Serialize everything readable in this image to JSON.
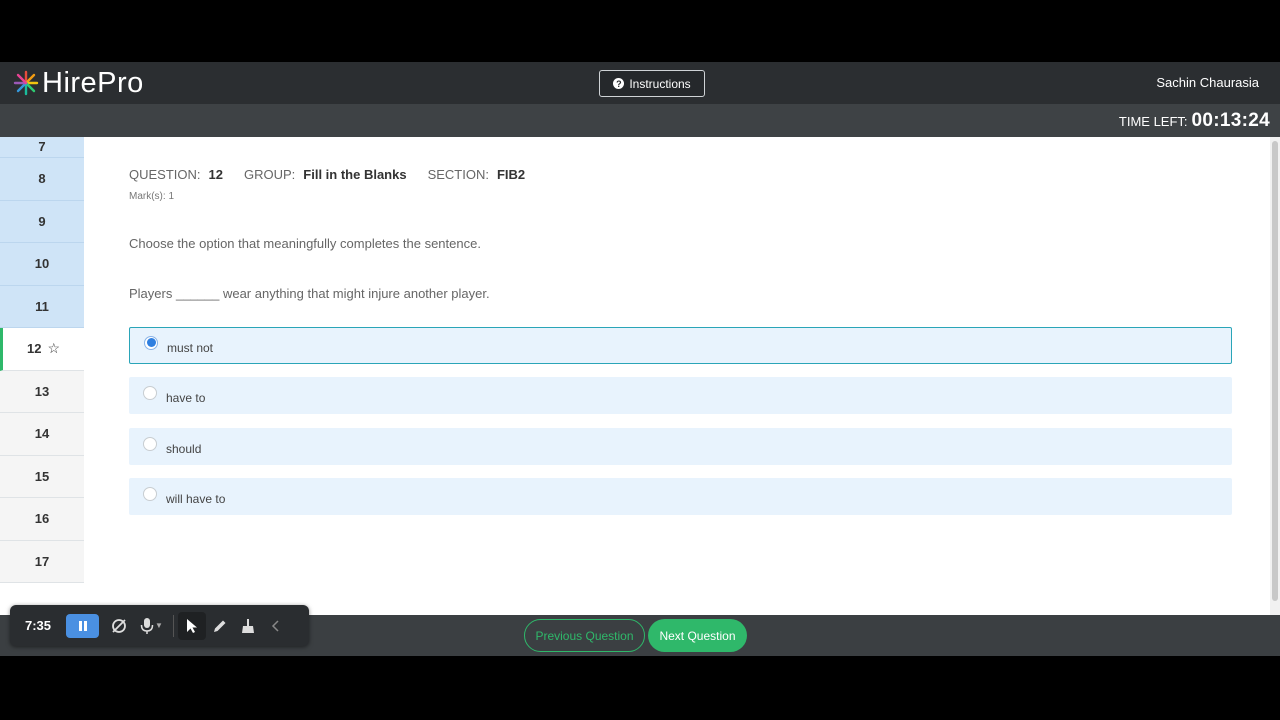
{
  "header": {
    "logo_text": "HirePro",
    "instructions_label": "Instructions",
    "user_name": "Sachin Chaurasia"
  },
  "timer": {
    "label": "TIME LEFT:",
    "value": "00:13:24"
  },
  "sidebar": {
    "items": [
      {
        "number": "7",
        "status": "answered"
      },
      {
        "number": "8",
        "status": "answered"
      },
      {
        "number": "9",
        "status": "answered"
      },
      {
        "number": "10",
        "status": "answered"
      },
      {
        "number": "11",
        "status": "answered"
      },
      {
        "number": "12",
        "status": "current"
      },
      {
        "number": "13",
        "status": "unanswered"
      },
      {
        "number": "14",
        "status": "unanswered"
      },
      {
        "number": "15",
        "status": "unanswered"
      },
      {
        "number": "16",
        "status": "unanswered"
      },
      {
        "number": "17",
        "status": "unanswered"
      }
    ]
  },
  "question": {
    "question_label": "QUESTION:",
    "question_number": "12",
    "group_label": "GROUP:",
    "group_value": "Fill in the Blanks",
    "section_label": "SECTION:",
    "section_value": "FIB2",
    "marks_text": "Mark(s):  1",
    "instruction": "Choose the option that meaningfully completes the sentence.",
    "sentence": "Players ______ wear anything that might injure another player.",
    "options": [
      {
        "text": "must not",
        "selected": true
      },
      {
        "text": "have to",
        "selected": false
      },
      {
        "text": "should",
        "selected": false
      },
      {
        "text": "will have to",
        "selected": false
      }
    ]
  },
  "footer": {
    "previous_label": "Previous Question",
    "next_label": "Next Question"
  },
  "recorder": {
    "elapsed": "7:35"
  },
  "colors": {
    "accent_green": "#2fb86a",
    "answered_blue": "#cfe4f7",
    "option_bg": "#e8f3fd",
    "radio_blue": "#2f7fe0"
  }
}
